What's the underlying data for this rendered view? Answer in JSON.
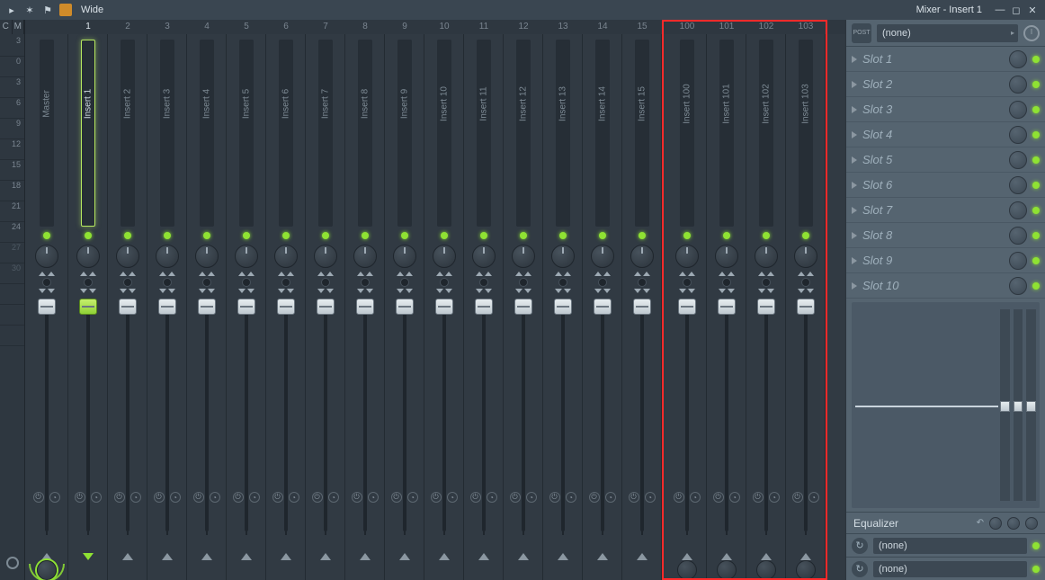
{
  "title": "Mixer - Insert 1",
  "view_mode": "Wide",
  "ruler": {
    "cols": [
      "C",
      "M"
    ],
    "ticks": [
      "3",
      "0",
      "3",
      "6",
      "9",
      "12",
      "15",
      "18",
      "21",
      "24",
      "27",
      "30",
      "",
      "",
      ""
    ]
  },
  "tracks": {
    "master": {
      "label": "Master"
    },
    "visible_main": [
      {
        "num": "1",
        "label": "Insert 1",
        "selected": true
      },
      {
        "num": "2",
        "label": "Insert 2"
      },
      {
        "num": "3",
        "label": "Insert 3"
      },
      {
        "num": "4",
        "label": "Insert 4"
      },
      {
        "num": "5",
        "label": "Insert 5"
      },
      {
        "num": "6",
        "label": "Insert 6"
      },
      {
        "num": "7",
        "label": "Insert 7"
      },
      {
        "num": "8",
        "label": "Insert 8"
      },
      {
        "num": "9",
        "label": "Insert 9"
      },
      {
        "num": "10",
        "label": "Insert 10"
      },
      {
        "num": "11",
        "label": "Insert 11"
      },
      {
        "num": "12",
        "label": "Insert 12"
      },
      {
        "num": "13",
        "label": "Insert 13"
      },
      {
        "num": "14",
        "label": "Insert 14"
      },
      {
        "num": "15",
        "label": "Insert 15"
      }
    ],
    "visible_tail": [
      {
        "num": "100",
        "label": "Insert 100"
      },
      {
        "num": "101",
        "label": "Insert 101"
      },
      {
        "num": "102",
        "label": "Insert 102"
      },
      {
        "num": "103",
        "label": "Insert 103"
      }
    ]
  },
  "slots": {
    "input_routing": "(none)",
    "items": [
      {
        "label": "Slot 1"
      },
      {
        "label": "Slot 2"
      },
      {
        "label": "Slot 3"
      },
      {
        "label": "Slot 4"
      },
      {
        "label": "Slot 5"
      },
      {
        "label": "Slot 6"
      },
      {
        "label": "Slot 7"
      },
      {
        "label": "Slot 8"
      },
      {
        "label": "Slot 9"
      },
      {
        "label": "Slot 10"
      }
    ],
    "equalizer_label": "Equalizer",
    "output_routing_a": "(none)",
    "output_routing_b": "(none)"
  },
  "post_label": "POST"
}
